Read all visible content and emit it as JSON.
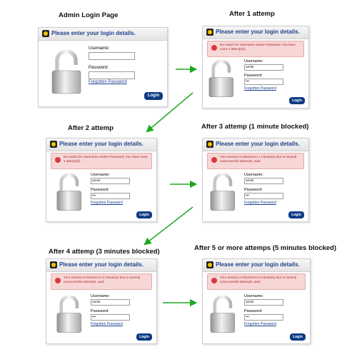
{
  "captions": {
    "s0": "Admin Login Page",
    "s1": "After 1 attemp",
    "s2": "After 2 attemp",
    "s3": "After 3 attemp (1 minute blocked)",
    "s4": "After 4 attemp (3 minutes blocked)",
    "s5": "After 5 or more attemps (5 minutes blocked)"
  },
  "login": {
    "header_title": "Please enter your login details.",
    "username_label": "Username:",
    "password_label": "Password:",
    "forgot_link": "Forgotten Password",
    "login_button": "Login"
  },
  "screens": {
    "s1": {
      "username": "amlst",
      "password": "•••",
      "error": "No match for Username and/or Password. You have more 2 attemp(s)."
    },
    "s2": {
      "username": "amlst",
      "password": "•••",
      "error": "No match for Username and/or Password. You have more 1 attemp(s)."
    },
    "s3": {
      "username": "amlst",
      "password": "•••",
      "error": "Your session is blocked to 1 minute(s) due to several unsuccessful attempts, wait."
    },
    "s4": {
      "username": "amlst",
      "password": "•••",
      "error": "Your session is blocked to 3 minute(s) due to several unsuccessful attempts, wait."
    },
    "s5": {
      "username": "amlst",
      "password": "•••",
      "error": "Your session is blocked to 5 minute(s) due to several unsuccessful attempts, wait."
    }
  },
  "colors": {
    "arrow": "#1fa81f",
    "header_title": "#21408d",
    "error_bg": "#f7d6d6",
    "error_text": "#b02828",
    "button": "#0e3a84"
  },
  "icons": {
    "header": "login-badge-icon",
    "lock": "padlock-icon",
    "error": "warning-icon"
  }
}
